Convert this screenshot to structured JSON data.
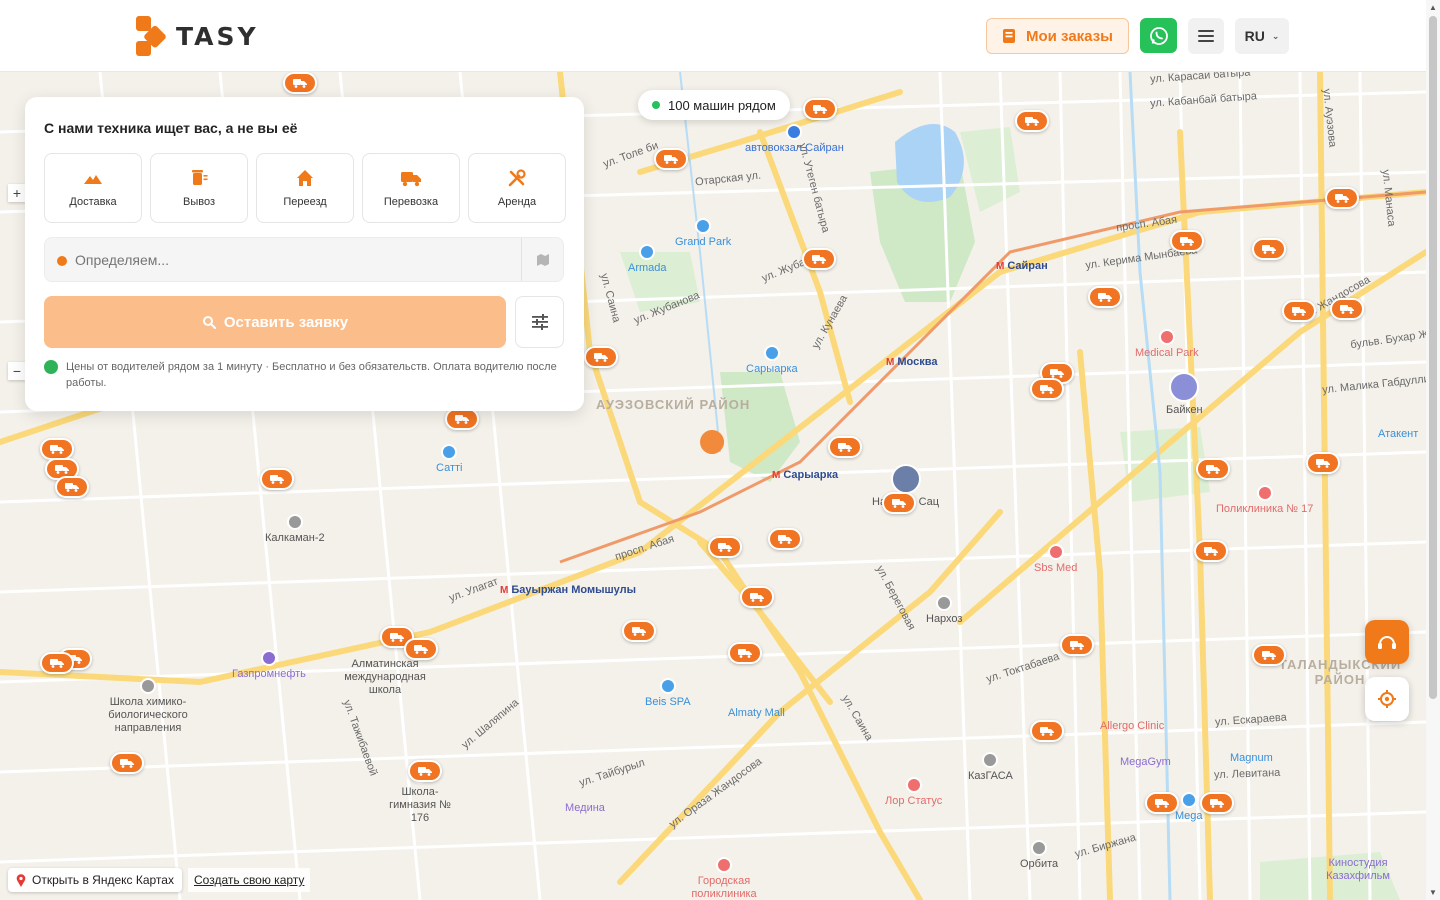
{
  "header": {
    "brand": "TASY",
    "orders_label": "Мои заказы",
    "lang": "RU"
  },
  "panel": {
    "title": "С нами техника ищет вас, а не вы её",
    "services": [
      {
        "label": "Доставка",
        "icon": "truck-hill-icon"
      },
      {
        "label": "Вывоз",
        "icon": "bin-icon"
      },
      {
        "label": "Переезд",
        "icon": "home-icon"
      },
      {
        "label": "Перевозка",
        "icon": "truck-icon"
      },
      {
        "label": "Аренда",
        "icon": "tools-icon"
      }
    ],
    "address_placeholder": "Определяем...",
    "submit_label": "Оставить заявку",
    "note": "Цены от водителей рядом за 1 минуту · Бесплатно и без обязательств. Оплата водителю после работы."
  },
  "map": {
    "nearby_label": "100 машин рядом",
    "open_yandex": "Открыть в Яндекс Картах",
    "create_map": "Создать свою карту",
    "districts": [
      {
        "text": "АУЭЗОВСКИЙ РАЙОН"
      },
      {
        "text": "ТАЛАНДЫКСКИЙ РАЙОН"
      }
    ],
    "metro": [
      "Сайран",
      "Москва",
      "Сарыарка",
      "Бауыржан Момышулы"
    ],
    "places": [
      "автовокзал Сайран",
      "Grand Park",
      "Armada",
      "Сарыарка",
      "Medical Park",
      "Байкен",
      "Наталии Сац",
      "Sbs Med",
      "Поликлиника № 17",
      "Нархоз",
      "Allergo Clinic",
      "MegaGym",
      "Magnum",
      "Mega",
      "Лор Статус",
      "КазГАСА",
      "Орбита",
      "Almaty Mall",
      "Beis SPA",
      "Медина",
      "Газпромнефть",
      "Алматинская международная школа",
      "Школа химико-биологического направления",
      "Школа-гимназия № 176",
      "Калкаман-2",
      "Сатті",
      "Городская поликлиника",
      "Киностудия Казахфильм",
      "Атакент"
    ],
    "streets": [
      "ул. Толе би",
      "Отарская ул.",
      "ул. Жубанова",
      "ул. Жубанова",
      "просп. Абая",
      "просп. Абая",
      "ул. Саина",
      "ул. Саина",
      "ул. Утеген батыра",
      "ул. Кунаева",
      "ул. Карасай батыра",
      "ул. Кабанбай батыра",
      "ул. Керима Мынбаева",
      "ул. Ауэзова",
      "ул. Манаса",
      "бульв. Бухар Жырау",
      "ул. Малика Габдуллина",
      "ул. Жандосова",
      "ул. Ораза Жандосова",
      "ул. Береговая",
      "ул. Токтабаева",
      "ул. Ескараева",
      "ул. Левитана",
      "ул. Биржана",
      "ул. Тайбурыл",
      "ул. Шаляпина",
      "ул. Улагат",
      "ул. Тажибаевой"
    ]
  }
}
